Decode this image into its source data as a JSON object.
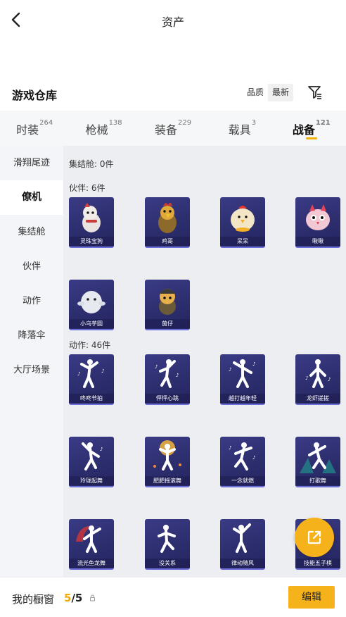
{
  "header": {
    "title": "资产"
  },
  "section": {
    "title": "游戏仓库",
    "sort_quality": "品质",
    "sort_newest": "最新"
  },
  "tabs": [
    {
      "label": "时装",
      "count": "264"
    },
    {
      "label": "枪械",
      "count": "138"
    },
    {
      "label": "装备",
      "count": "229"
    },
    {
      "label": "载具",
      "count": "3"
    },
    {
      "label": "战备",
      "count": "121"
    }
  ],
  "active_tab": "战备",
  "side_menu": [
    "滑翔尾迹",
    "僚机",
    "集结舱",
    "伙伴",
    "动作",
    "降落伞",
    "大厅场景"
  ],
  "active_side": "僚机",
  "groups": {
    "capsule": "集结舱: 0件",
    "partner": "伙伴: 6件",
    "emote": "动作: 46件"
  },
  "partners": [
    "灵珠宝狗",
    "鸡哥",
    "呆呆",
    "啾啾",
    "小乌芋圆",
    "茵仔"
  ],
  "emotes": [
    "咚咚节拍",
    "怦怦心跳",
    "越打越年轻",
    "龙虾搓搓",
    "玲珑起舞",
    "肥肥摇滚舞",
    "一念就燃",
    "打歌舞",
    "流光鱼龙舞",
    "没关系",
    "律动随风",
    "技能五子棋"
  ],
  "bottom": {
    "label": "我的橱窗",
    "used": "5",
    "sep": "/",
    "total": "5",
    "edit": "编辑"
  },
  "colors": {
    "accent": "#f5b21b",
    "card_bg": "#2d2e6e",
    "content_bg": "#eceef2"
  }
}
